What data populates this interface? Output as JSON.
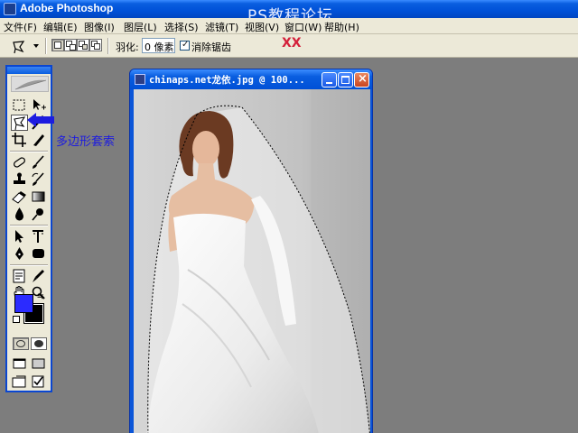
{
  "app": {
    "title": "Adobe Photoshop",
    "watermark": "PS教程论坛",
    "watermark_sub": "XX"
  },
  "menu": [
    "文件(F)",
    "编辑(E)",
    "图像(I)",
    "图层(L)",
    "选择(S)",
    "滤镜(T)",
    "视图(V)",
    "窗口(W)",
    "帮助(H)"
  ],
  "options": {
    "feather_label": "羽化:",
    "feather_value": "0 像素",
    "anti_alias_label": "消除锯齿",
    "anti_alias_checked": true
  },
  "tools": {
    "active": "polygonal-lasso-tool",
    "foreground_color": "#2b2bff",
    "background_color": "#000000"
  },
  "annotation": {
    "label": "多边形套索",
    "color": "#1d1ce0"
  },
  "document": {
    "title": "chinaps.net龙依.jpg @ 100..."
  },
  "colors": {
    "xp_blue": "#0a5ee0",
    "chrome": "#ece9d8",
    "workspace": "#7d7d7d"
  }
}
